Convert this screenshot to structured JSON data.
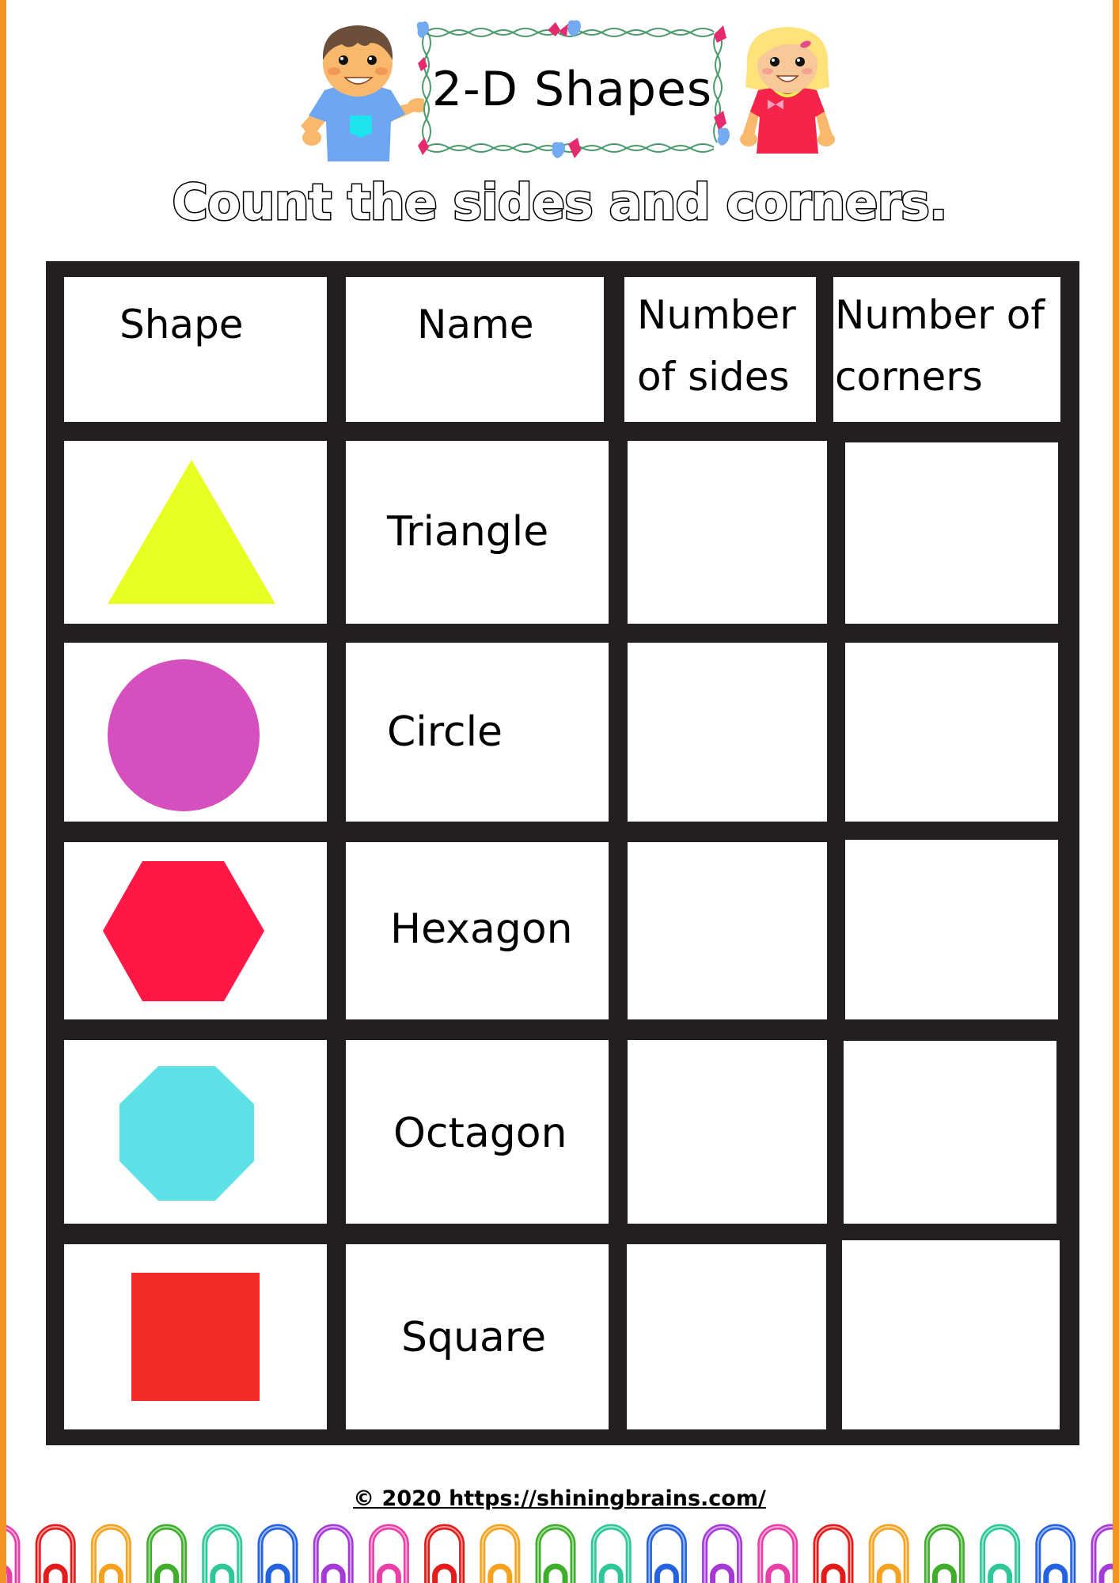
{
  "header": {
    "title": "2-D Shapes",
    "subtitle": "Count the sides and corners."
  },
  "table": {
    "columns": [
      {
        "label": "Shape"
      },
      {
        "label": "Name"
      },
      {
        "label_line1": "Number",
        "label_line2": "of sides"
      },
      {
        "label_line1": "Number of",
        "label_line2": "corners"
      }
    ],
    "rows": [
      {
        "shape_icon": "triangle-icon",
        "color": "#e8ff22",
        "name": "Triangle",
        "sides": "",
        "corners": ""
      },
      {
        "shape_icon": "circle-icon",
        "color": "#d64fbf",
        "name": "Circle",
        "sides": "",
        "corners": ""
      },
      {
        "shape_icon": "hexagon-icon",
        "color": "#ff1746",
        "name": "Hexagon",
        "sides": "",
        "corners": ""
      },
      {
        "shape_icon": "octagon-icon",
        "color": "#5ee1e6",
        "name": "Octagon",
        "sides": "",
        "corners": ""
      },
      {
        "shape_icon": "square-icon",
        "color": "#f22d25",
        "name": "Square",
        "sides": "",
        "corners": ""
      }
    ]
  },
  "footer": {
    "copyright": "© 2020 https://shiningbrains.com/"
  },
  "colors": {
    "page_border": "#f39322",
    "table_border": "#231f20",
    "paperclips": [
      "#e83fa8",
      "#e21b1b",
      "#f6a21f",
      "#3fae2a",
      "#2fc79a",
      "#2462e0",
      "#a63ad6"
    ]
  }
}
